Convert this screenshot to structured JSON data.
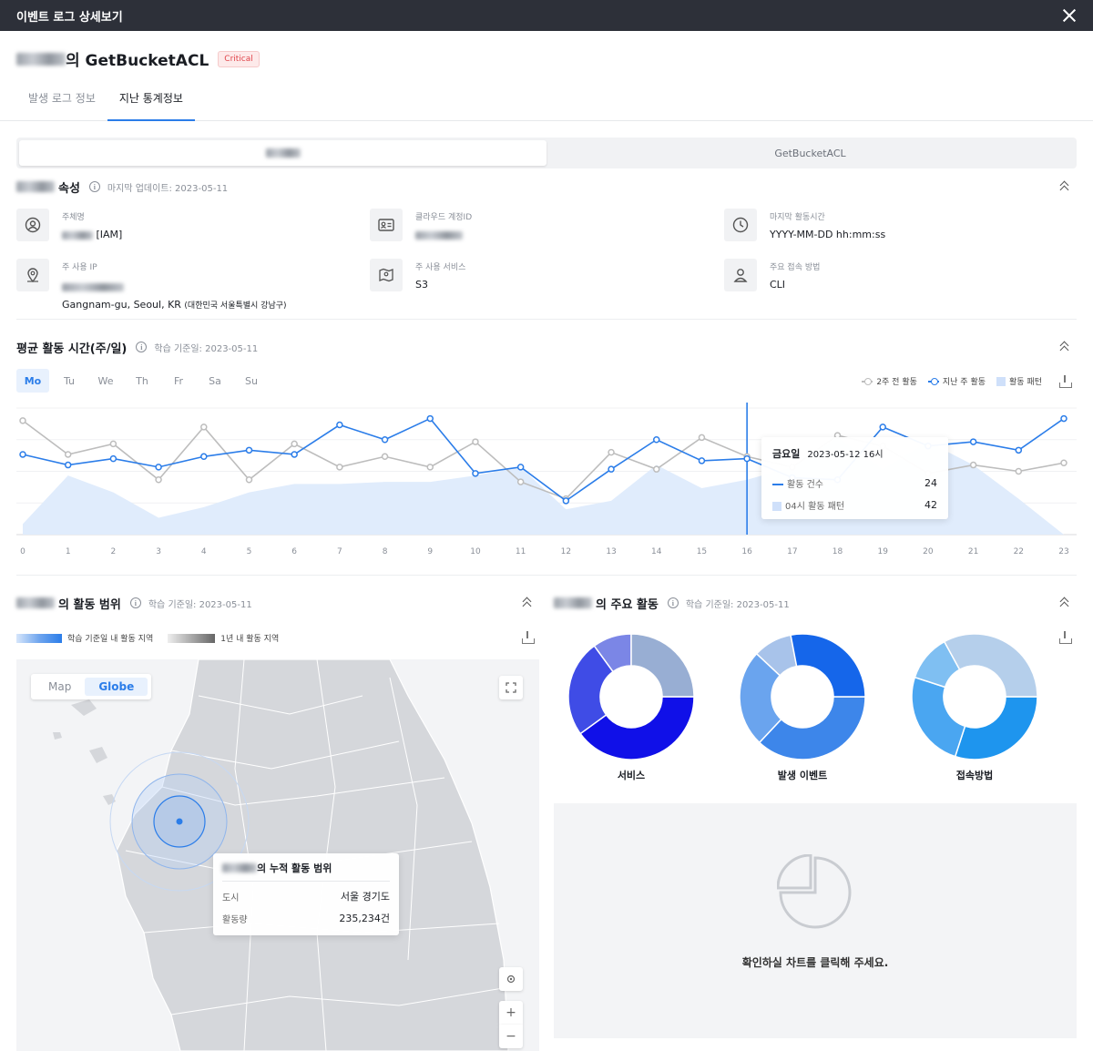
{
  "window": {
    "title": "이벤트 로그 상세보기"
  },
  "header": {
    "name_suffix": "의 GetBucketACL",
    "badge": "Critical"
  },
  "tabs": [
    {
      "label": "발생 로그 정보"
    },
    {
      "label": "지난 통계정보"
    }
  ],
  "segment": {
    "right": "GetBucketACL"
  },
  "attributes": {
    "title": "속성",
    "updated": "마지막 업데이트: 2023-05-11",
    "items": [
      {
        "label": "주체명",
        "value": "[IAM]"
      },
      {
        "label": "클라우드 계정ID",
        "value": ""
      },
      {
        "label": "마지막 활동시간",
        "value": "YYYY-MM-DD hh:mm:ss"
      },
      {
        "label": "주 사용 IP",
        "value": "Gangnam-gu, Seoul, KR",
        "value_small": "(대한민국 서울특별시 강남구)"
      },
      {
        "label": "주 사용 서비스",
        "value": "S3"
      },
      {
        "label": "주요 접속 방법",
        "value": "CLI"
      }
    ]
  },
  "activity_time": {
    "title": "평균 활동 시간(주/일)",
    "learned": "학습 기준일: 2023-05-11",
    "days": [
      "Mo",
      "Tu",
      "We",
      "Th",
      "Fr",
      "Sa",
      "Su"
    ],
    "legend": {
      "two_weeks": "2주 전 활동",
      "last_week": "지난 주 활동",
      "pattern": "활동 패턴"
    },
    "tooltip": {
      "day": "금요일",
      "date": "2023-05-12 16시",
      "row1_label": "활동 건수",
      "row1_value": "24",
      "row2_label": "04시 활동 패턴",
      "row2_value": "42"
    }
  },
  "chart_data": {
    "type": "line",
    "x": [
      0,
      1,
      2,
      3,
      4,
      5,
      6,
      7,
      8,
      9,
      10,
      11,
      12,
      13,
      14,
      15,
      16,
      17,
      18,
      19,
      20,
      21,
      22,
      23
    ],
    "series": [
      {
        "name": "2주 전 활동",
        "values": [
          54,
          38,
          43,
          26,
          51,
          26,
          43,
          32,
          37,
          32,
          44,
          25,
          17,
          39,
          31,
          46,
          37,
          32,
          47,
          42,
          29,
          33,
          30,
          34
        ]
      },
      {
        "name": "지난 주 활동",
        "values": [
          38,
          33,
          36,
          32,
          37,
          40,
          38,
          52,
          45,
          55,
          29,
          32,
          16,
          31,
          45,
          35,
          36,
          27,
          26,
          51,
          42,
          44,
          40,
          55
        ]
      },
      {
        "name": "활동 패턴",
        "values": [
          5,
          28,
          20,
          8,
          13,
          20,
          24,
          24,
          25,
          25,
          28,
          32,
          12,
          16,
          33,
          22,
          26,
          32,
          46,
          31,
          44,
          33,
          17,
          0
        ]
      }
    ],
    "ylim": [
      0,
      60
    ]
  },
  "scope": {
    "title_suffix": "의 활동 범위",
    "learned": "학습 기준일: 2023-05-11",
    "legend_learn": "학습 기준일 내 활동 지역",
    "legend_year": "1년 내 활동 지역",
    "map_tabs": [
      "Map",
      "Globe"
    ],
    "tip_title_suffix": "의 누적 활동 범위",
    "tip_rows": [
      {
        "label": "도시",
        "value": "서울 경기도"
      },
      {
        "label": "활동량",
        "value": "235,234건"
      }
    ]
  },
  "main_activity": {
    "title_suffix": "의 주요 활동",
    "learned": "학습 기준일: 2023-05-11",
    "donuts": [
      {
        "label": "서비스",
        "slices": [
          40,
          25,
          10,
          25
        ],
        "colors": [
          "#1010e8",
          "#3f4ce6",
          "#7b86e6",
          "#98aed3"
        ]
      },
      {
        "label": "발생 이벤트",
        "slices": [
          37,
          25,
          10,
          28
        ],
        "colors": [
          "#3d86ea",
          "#6aa4ee",
          "#a8c3ea",
          "#1566ea"
        ]
      },
      {
        "label": "접속방법",
        "slices": [
          30,
          25,
          12,
          33
        ],
        "colors": [
          "#1e95ee",
          "#4aa6f1",
          "#7fbff2",
          "#b5cfeb"
        ]
      }
    ],
    "empty_msg": "확인하실 차트를 클릭해 주세요."
  },
  "colors": {
    "accent": "#2b7de9",
    "gray_line": "#bdbdbd",
    "pattern": "#e0ecfc",
    "critical": "#e0454b"
  }
}
